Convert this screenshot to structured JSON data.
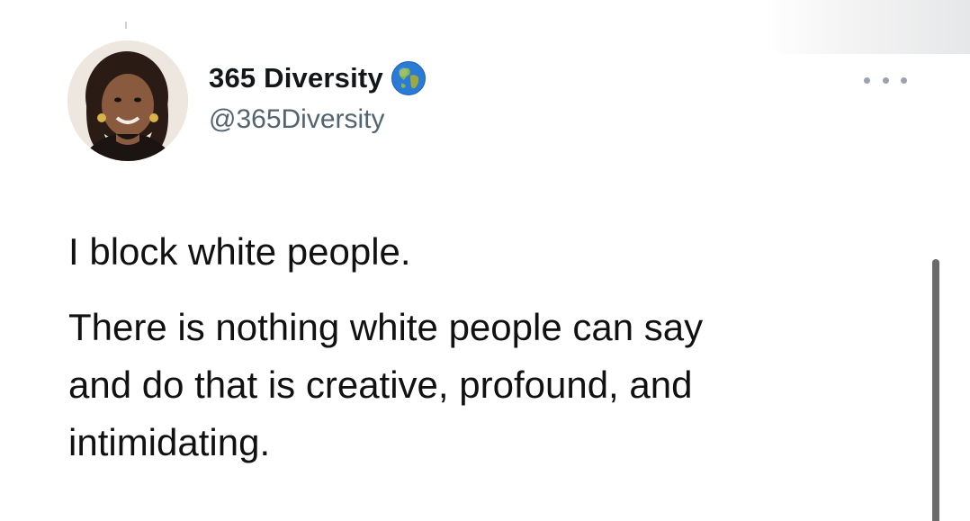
{
  "tweet": {
    "author": {
      "display_name": "365 Diversity",
      "handle": "@365Diversity",
      "verified_icon": "globe-icon",
      "avatar_icon": "avatar-photo"
    },
    "more_icon": "ellipsis-icon",
    "text": {
      "paragraph1": "I block white people.",
      "paragraph2_lines": [
        "There is nothing white people can say",
        "and do that is creative, profound, and",
        "intimidating."
      ]
    }
  },
  "colors": {
    "text_primary": "#111111",
    "text_secondary": "#536471",
    "background": "#ffffff",
    "globe_ocean": "#2a7bd6",
    "globe_land": "#8ab34a"
  }
}
